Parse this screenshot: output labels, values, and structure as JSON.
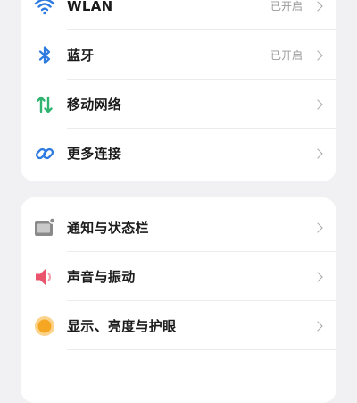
{
  "connectivity": {
    "items": [
      {
        "label": "WLAN",
        "status": "已开启",
        "icon": "wifi-icon",
        "color": "#2e7be0"
      },
      {
        "label": "蓝牙",
        "status": "已开启",
        "icon": "bluetooth-icon",
        "color": "#2e7be0"
      },
      {
        "label": "移动网络",
        "status": "",
        "icon": "mobile-data-icon",
        "color": "#2fb36f"
      },
      {
        "label": "更多连接",
        "status": "",
        "icon": "link-icon",
        "color": "#2e7be0"
      }
    ]
  },
  "system": {
    "items": [
      {
        "label": "通知与状态栏",
        "icon": "notification-icon",
        "color": "#8a8a8a"
      },
      {
        "label": "声音与振动",
        "icon": "speaker-icon",
        "color": "#e9536b"
      },
      {
        "label": "显示、亮度与护眼",
        "icon": "display-icon",
        "color": "#f5a623"
      }
    ]
  }
}
